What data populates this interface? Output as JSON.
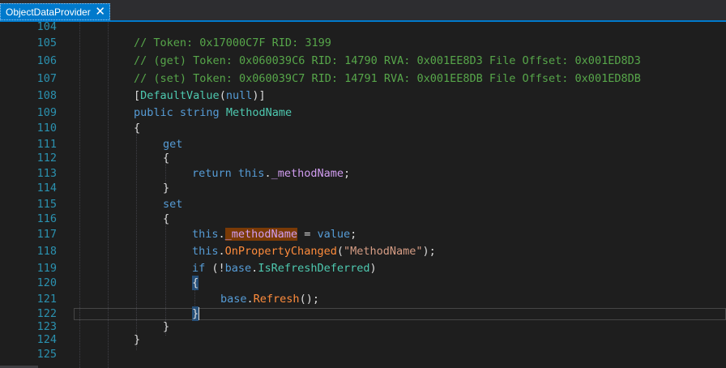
{
  "tab": {
    "title": "ObjectDataProvider",
    "close_icon": "close-icon"
  },
  "colors": {
    "accent": "#007acc",
    "editor_background": "#1e1e1e",
    "line_number": "#2b91af",
    "comment": "#57a64a",
    "keyword": "#569cd6",
    "type": "#4ec9b0",
    "method": "#ff8c3c",
    "field": "#c586c0",
    "string": "#d69d85",
    "highlight": "#7a3a06"
  },
  "editor": {
    "line_numbers": [
      "104",
      "105",
      "106",
      "107",
      "108",
      "109",
      "110",
      "111",
      "112",
      "113",
      "114",
      "115",
      "116",
      "117",
      "118",
      "119",
      "120",
      "121",
      "122",
      "123",
      "124",
      "125"
    ],
    "lines": {
      "l105": "// Token: 0x17000C7F RID: 3199",
      "l106": "// (get) Token: 0x060039C6 RID: 14790 RVA: 0x001EE8D3 File Offset: 0x001ED8D3",
      "l107": "// (set) Token: 0x060039C7 RID: 14791 RVA: 0x001EE8DB File Offset: 0x001ED8DB",
      "l108": {
        "open": "[",
        "attr": "DefaultValue",
        "paren_open": "(",
        "arg": "null",
        "close": ")]"
      },
      "l109": {
        "kw1": "public",
        "kw2": "string",
        "name": "MethodName"
      },
      "l110": "{",
      "l111": "get",
      "l112": "{",
      "l113": {
        "kw": "return",
        "this": "this",
        "dot": ".",
        "field": "_methodName",
        "end": ";"
      },
      "l114": "}",
      "l115": "set",
      "l116": "{",
      "l117": {
        "this": "this",
        "dot": ".",
        "field": "_methodName",
        "eq": " = ",
        "val": "value",
        "end": ";"
      },
      "l118": {
        "this": "this",
        "dot": ".",
        "method": "OnPropertyChanged",
        "open": "(",
        "str": "\"MethodName\"",
        "close": ");"
      },
      "l119": {
        "kw": "if",
        "open": " (!",
        "base": "base",
        "dot": ".",
        "prop": "IsRefreshDeferred",
        "close": ")"
      },
      "l120": "{",
      "l121": {
        "base": "base",
        "dot": ".",
        "method": "Refresh",
        "end": "();"
      },
      "l122": "}",
      "l123": "}",
      "l124": "}"
    }
  }
}
